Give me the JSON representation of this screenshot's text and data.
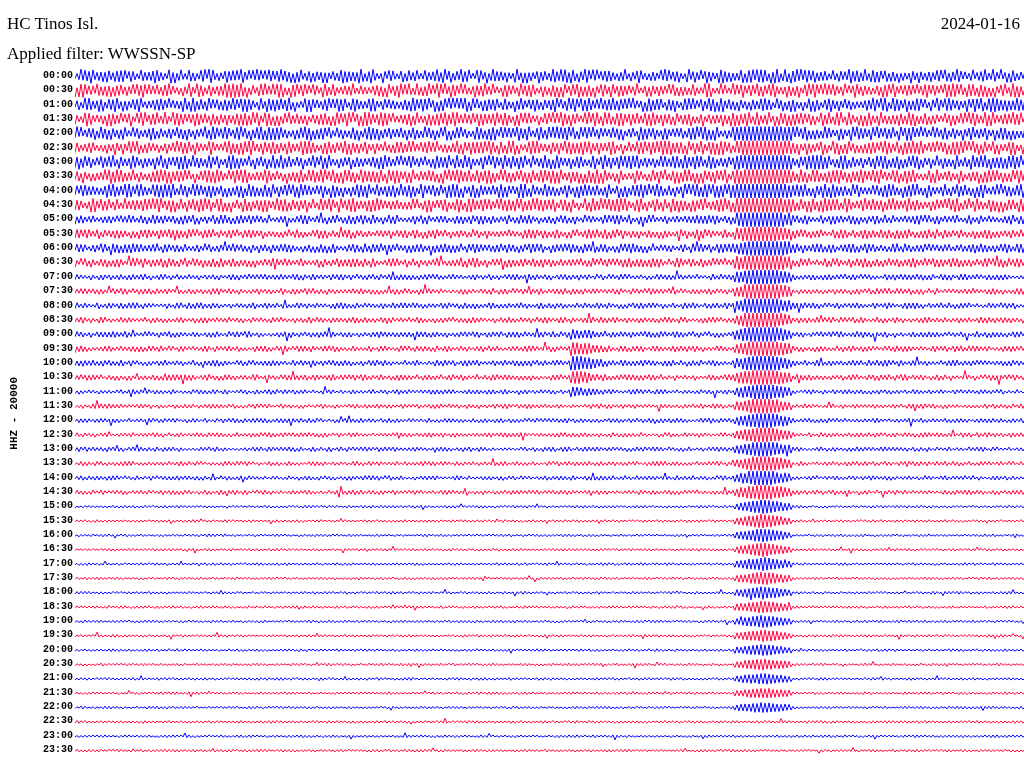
{
  "header": {
    "station": "HC Tinos Isl.",
    "date": "2024-01-16",
    "filter": "Applied filter: WWSSN-SP"
  },
  "channel_label": "HHZ - 20000",
  "traces": [
    {
      "time": "00:00",
      "color": "#0000ff"
    },
    {
      "time": "00:30",
      "color": "#ff0040"
    },
    {
      "time": "01:00",
      "color": "#0000ff"
    },
    {
      "time": "01:30",
      "color": "#ff0040"
    },
    {
      "time": "02:00",
      "color": "#0000ff"
    },
    {
      "time": "02:30",
      "color": "#ff0040"
    },
    {
      "time": "03:00",
      "color": "#0000ff"
    },
    {
      "time": "03:30",
      "color": "#ff0040"
    },
    {
      "time": "04:00",
      "color": "#0000ff"
    },
    {
      "time": "04:30",
      "color": "#ff0040"
    },
    {
      "time": "05:00",
      "color": "#0000ff"
    },
    {
      "time": "05:30",
      "color": "#ff0040"
    },
    {
      "time": "06:00",
      "color": "#0000ff"
    },
    {
      "time": "06:30",
      "color": "#ff0040"
    },
    {
      "time": "07:00",
      "color": "#0000ff"
    },
    {
      "time": "07:30",
      "color": "#ff0040"
    },
    {
      "time": "08:00",
      "color": "#0000ff"
    },
    {
      "time": "08:30",
      "color": "#ff0040"
    },
    {
      "time": "09:00",
      "color": "#0000ff"
    },
    {
      "time": "09:30",
      "color": "#ff0040"
    },
    {
      "time": "10:00",
      "color": "#0000ff"
    },
    {
      "time": "10:30",
      "color": "#ff0040"
    },
    {
      "time": "11:00",
      "color": "#0000ff"
    },
    {
      "time": "11:30",
      "color": "#ff0040"
    },
    {
      "time": "12:00",
      "color": "#0000ff"
    },
    {
      "time": "12:30",
      "color": "#ff0040"
    },
    {
      "time": "13:00",
      "color": "#0000ff"
    },
    {
      "time": "13:30",
      "color": "#ff0040"
    },
    {
      "time": "14:00",
      "color": "#0000ff"
    },
    {
      "time": "14:30",
      "color": "#ff0040"
    },
    {
      "time": "15:00",
      "color": "#0000ff"
    },
    {
      "time": "15:30",
      "color": "#ff0040"
    },
    {
      "time": "16:00",
      "color": "#0000ff"
    },
    {
      "time": "16:30",
      "color": "#ff0040"
    },
    {
      "time": "17:00",
      "color": "#0000ff"
    },
    {
      "time": "17:30",
      "color": "#ff0040"
    },
    {
      "time": "18:00",
      "color": "#0000ff"
    },
    {
      "time": "18:30",
      "color": "#ff0040"
    },
    {
      "time": "19:00",
      "color": "#0000ff"
    },
    {
      "time": "19:30",
      "color": "#ff0040"
    },
    {
      "time": "20:00",
      "color": "#0000ff"
    },
    {
      "time": "20:30",
      "color": "#ff0040"
    },
    {
      "time": "21:00",
      "color": "#0000ff"
    },
    {
      "time": "21:30",
      "color": "#ff0040"
    },
    {
      "time": "22:00",
      "color": "#0000ff"
    },
    {
      "time": "22:30",
      "color": "#ff0040"
    },
    {
      "time": "23:00",
      "color": "#0000ff"
    },
    {
      "time": "23:30",
      "color": "#ff0040"
    }
  ]
}
